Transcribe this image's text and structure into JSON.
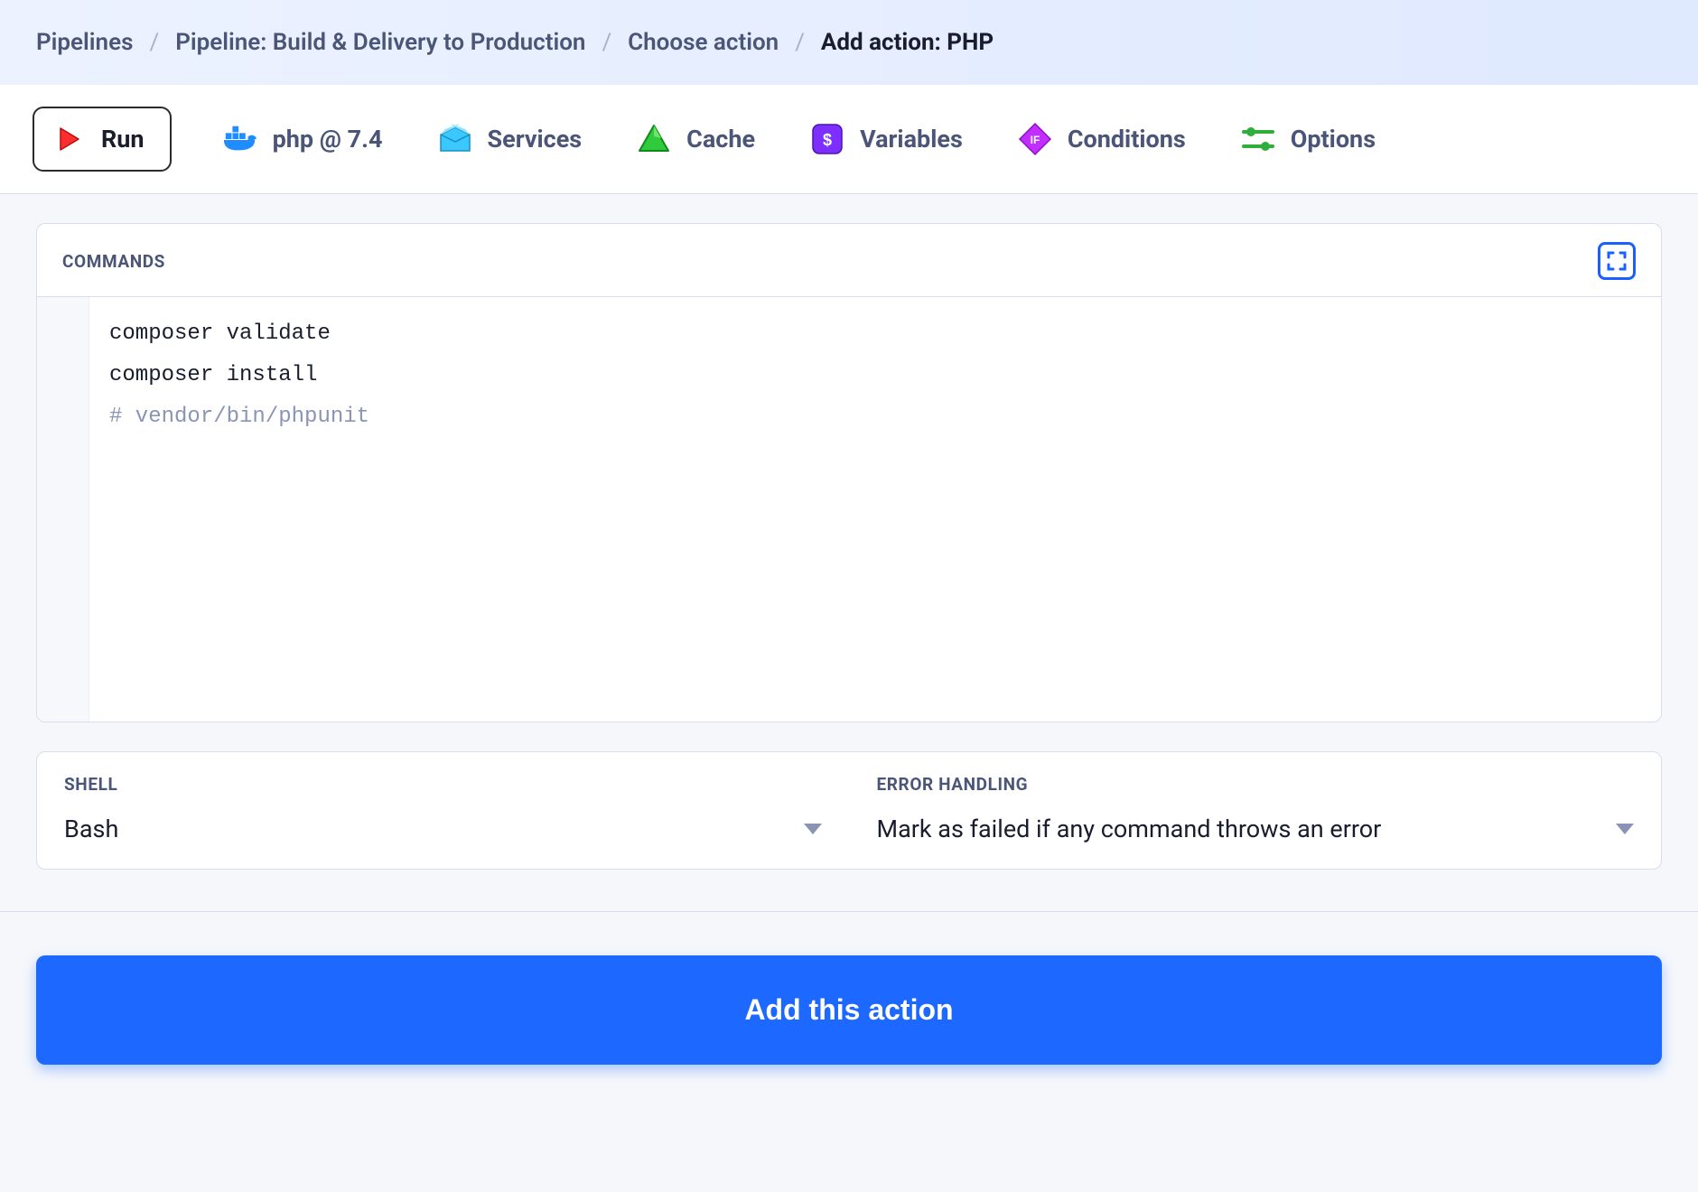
{
  "breadcrumb": {
    "pipelines": "Pipelines",
    "pipeline": "Pipeline: Build & Delivery to Production",
    "choose": "Choose action",
    "current": "Add action: PHP"
  },
  "tabs": {
    "run": "Run",
    "php": "php @ 7.4",
    "services": "Services",
    "cache": "Cache",
    "variables": "Variables",
    "conditions": "Conditions",
    "options": "Options"
  },
  "commands": {
    "label": "COMMANDS",
    "line1": "composer validate",
    "line2": "composer install",
    "line3": "# vendor/bin/phpunit"
  },
  "shell": {
    "label": "SHELL",
    "value": "Bash"
  },
  "error": {
    "label": "ERROR HANDLING",
    "value": "Mark as failed if any command throws an error"
  },
  "footer": {
    "submit": "Add this action"
  }
}
